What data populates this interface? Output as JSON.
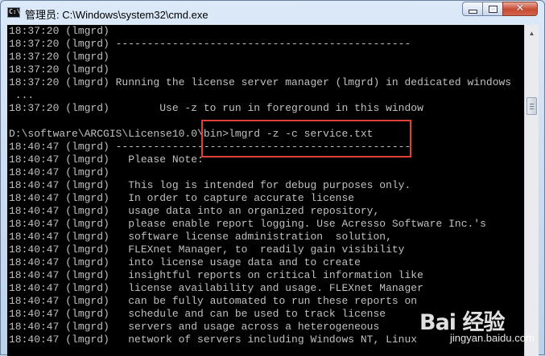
{
  "window": {
    "title": "管理员: C:\\Windows\\system32\\cmd.exe",
    "icon_text": "C:\\",
    "controls": {
      "minimize": "minimize",
      "maximize": "maximize",
      "close": "✕"
    }
  },
  "console": {
    "lines": [
      "18:37:20 (lmgrd)",
      "18:37:20 (lmgrd) -----------------------------------------------",
      "18:37:20 (lmgrd)",
      "18:37:20 (lmgrd)",
      "18:37:20 (lmgrd) Running the license server manager (lmgrd) in dedicated windows",
      " ...",
      "18:37:20 (lmgrd)        Use -z to run in foreground in this window",
      "",
      "D:\\software\\ARCGIS\\License10.0\\bin>lmgrd -z -c service.txt",
      "18:40:47 (lmgrd) -----------------------------------------------",
      "18:40:47 (lmgrd)   Please Note:",
      "18:40:47 (lmgrd)",
      "18:40:47 (lmgrd)   This log is intended for debug purposes only.",
      "18:40:47 (lmgrd)   In order to capture accurate license",
      "18:40:47 (lmgrd)   usage data into an organized repository,",
      "18:40:47 (lmgrd)   please enable report logging. Use Acresso Software Inc.'s",
      "18:40:47 (lmgrd)   software license administration  solution,",
      "18:40:47 (lmgrd)   FLEXnet Manager, to  readily gain visibility",
      "18:40:47 (lmgrd)   into license usage data and to create",
      "18:40:47 (lmgrd)   insightful reports on critical information like",
      "18:40:47 (lmgrd)   license availability and usage. FLEXnet Manager",
      "18:40:47 (lmgrd)   can be fully automated to run these reports on",
      "18:40:47 (lmgrd)   schedule and can be used to track license",
      "18:40:47 (lmgrd)   servers and usage across a heterogeneous",
      "18:40:47 (lmgrd)   network of servers including Windows NT, Linux"
    ]
  },
  "watermark": {
    "logo": "Bai 经验",
    "url": "jingyan.baidu.com"
  },
  "colors": {
    "console_bg": "#000000",
    "console_text": "#c0c0c0",
    "highlight_border": "#e0403a",
    "close_button": "#c74a33"
  }
}
